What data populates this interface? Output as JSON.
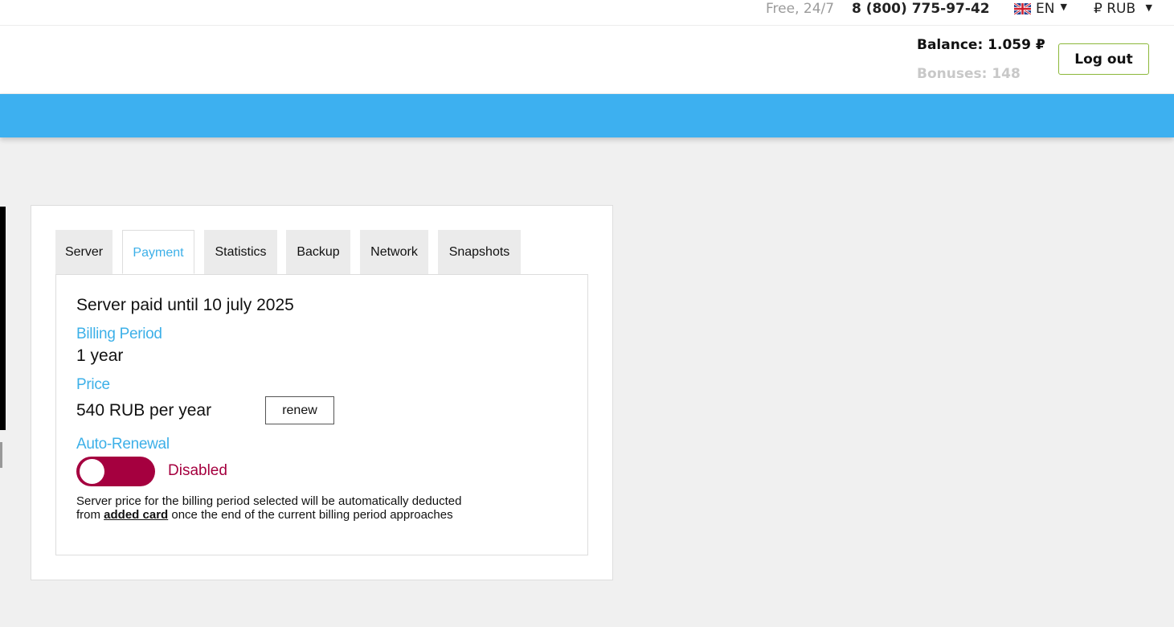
{
  "topbar": {
    "free": "Free, 24/7",
    "phone": "8 (800) 775-97-42",
    "language": "EN",
    "currency": "₽ RUB"
  },
  "header": {
    "balance": "Balance: 1.059 ₽",
    "bonuses": "Bonuses: 148",
    "logout_label": "Log out"
  },
  "tabs": [
    {
      "label": "Server"
    },
    {
      "label": "Payment"
    },
    {
      "label": "Statistics"
    },
    {
      "label": "Backup"
    },
    {
      "label": "Network"
    },
    {
      "label": "Snapshots"
    }
  ],
  "active_tab": "Payment",
  "payment": {
    "paid_until": "Server paid until 10 july 2025",
    "billing_period_label": "Billing Period",
    "billing_period_value": "1 year",
    "price_label": "Price",
    "price_value": "540 RUB per year",
    "renew_label": "renew",
    "auto_renewal_label": "Auto-Renewal",
    "auto_renewal_state": "Disabled",
    "note_before": "Server price for the billing period selected will be automatically deducted from ",
    "note_link": "added card",
    "note_after": " once the end of the current billing period approaches"
  },
  "colors": {
    "accent_blue": "#3db0e8",
    "disabled_red": "#a5003f",
    "logout_border": "#8cb83a"
  }
}
